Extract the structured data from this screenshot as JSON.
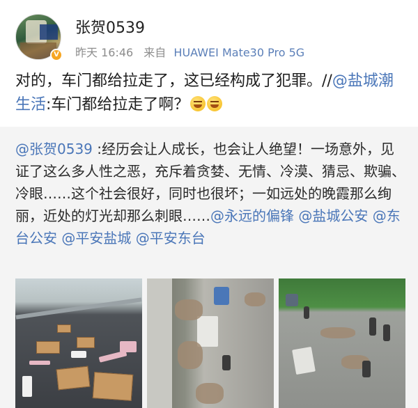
{
  "author": {
    "username": "张贺0539",
    "time": "昨天 16:46",
    "source_prefix": "来自",
    "device": "HUAWEI Mate30 Pro 5G"
  },
  "post": {
    "text": "对的，车门都给拉走了，这已经构成了犯罪。//",
    "mention": "@盐城潮生活",
    "quote": ":车门都给拉走了啊？"
  },
  "repost": {
    "mention_author": "@张贺0539",
    "text": " :经历会让人成长，也会让人绝望！一场意外，见证了这么多人性之恶，充斥着贪婪、无情、冷漠、猜忌、欺骗、冷眼……这个社会很好，同时也很坏；一如远处的晚霞那么绚丽，近处的灯光却那么刺眼……",
    "mentions": [
      "@永远的偏锋",
      "@盐城公安",
      "@东台公安",
      "@平安盐城",
      "@平安东台"
    ]
  },
  "icons": {
    "verified": "verified-badge-icon",
    "emoji": "laughing-emoji-icon"
  },
  "colors": {
    "link": "#4a76b8",
    "device": "#5b7fb8",
    "badge": "#f6a623",
    "repost_bg": "#f4f4f4"
  }
}
